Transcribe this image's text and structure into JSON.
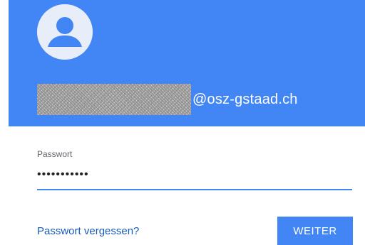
{
  "account": {
    "email_domain": "@osz-gstaad.ch"
  },
  "password_field": {
    "label": "Passwort",
    "value": "•••••••••••"
  },
  "actions": {
    "forgot_password": "Passwort vergessen?",
    "next": "WEITER"
  },
  "icons": {
    "avatar": "default-user-avatar-icon"
  },
  "colors": {
    "brand_blue": "#4285f4",
    "link_blue": "#1a5bb8",
    "avatar_bg": "#e8eef9",
    "avatar_figure": "#4285f4"
  }
}
